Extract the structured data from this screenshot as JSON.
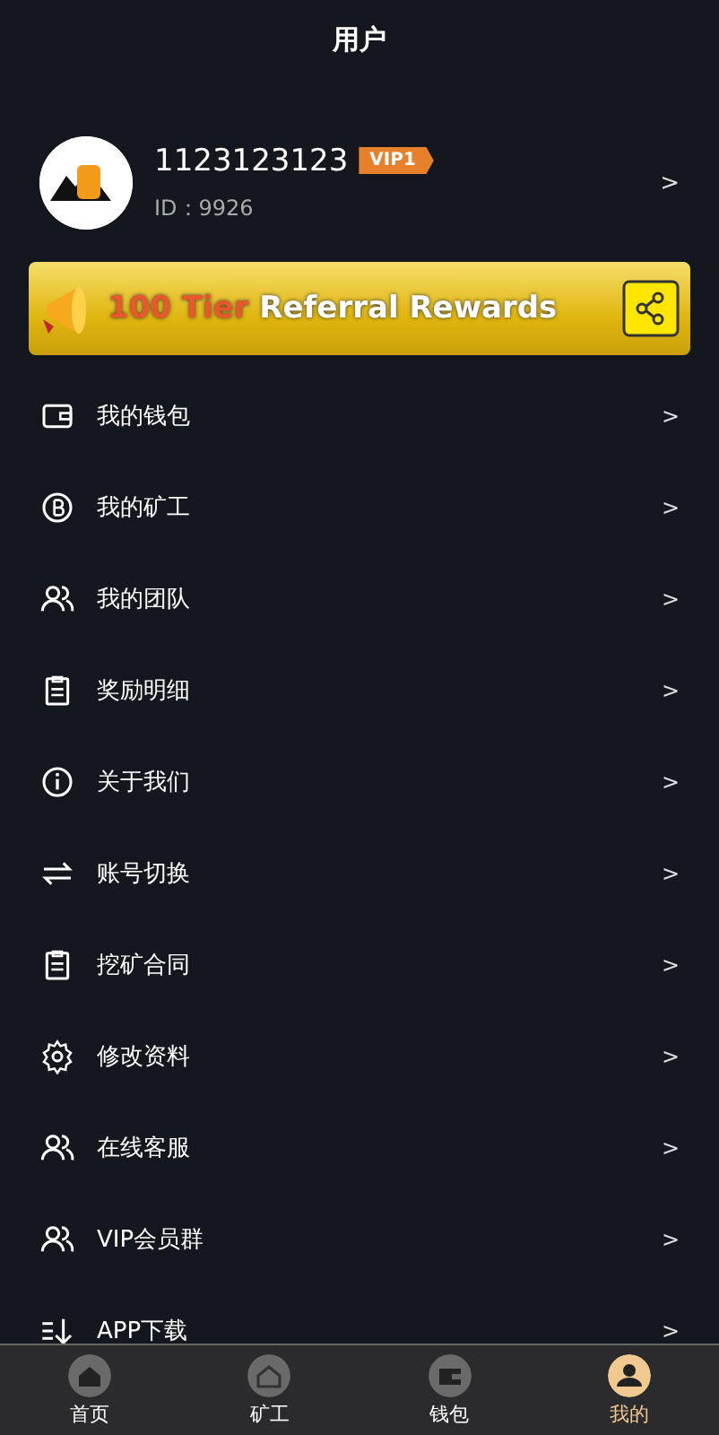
{
  "header": {
    "title": "用户"
  },
  "profile": {
    "username": "1123123123",
    "vip_badge": "VIP1",
    "user_id": "ID：9926",
    "chevron": ">"
  },
  "banner": {
    "highlight": "100 Tier",
    "text": "Referral Rewards"
  },
  "menu": [
    {
      "kind": "wallet",
      "label": "我的钱包",
      "chevron": ">"
    },
    {
      "kind": "coin",
      "label": "我的矿工",
      "chevron": ">"
    },
    {
      "kind": "people",
      "label": "我的团队",
      "chevron": ">"
    },
    {
      "kind": "clipboard",
      "label": "奖励明细",
      "chevron": ">"
    },
    {
      "kind": "info",
      "label": "关于我们",
      "chevron": ">"
    },
    {
      "kind": "swap",
      "label": "账号切换",
      "chevron": ">"
    },
    {
      "kind": "clipboard",
      "label": "挖矿合同",
      "chevron": ">"
    },
    {
      "kind": "gear",
      "label": "修改资料",
      "chevron": ">"
    },
    {
      "kind": "people",
      "label": "在线客服",
      "chevron": ">"
    },
    {
      "kind": "people",
      "label": "VIP会员群",
      "chevron": ">"
    },
    {
      "kind": "download",
      "label": "APP下载",
      "chevron": ">"
    }
  ],
  "tabbar": [
    {
      "kind": "home",
      "label": "首页",
      "selected": false
    },
    {
      "kind": "miner",
      "label": "矿工",
      "selected": false
    },
    {
      "kind": "wallet",
      "label": "钱包",
      "selected": false
    },
    {
      "kind": "user",
      "label": "我的",
      "selected": true
    }
  ]
}
